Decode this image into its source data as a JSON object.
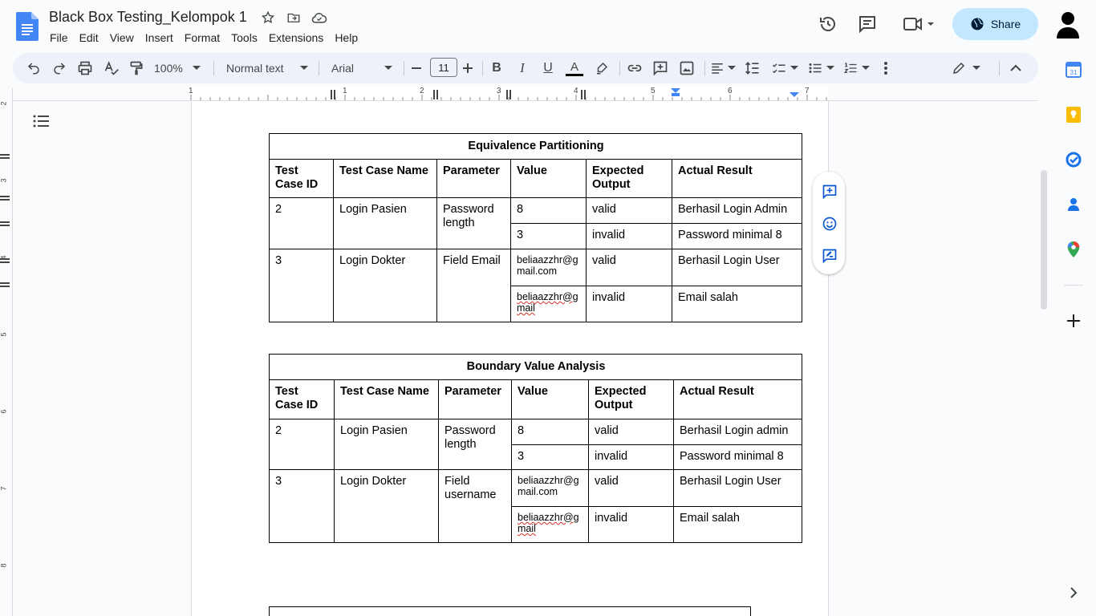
{
  "document": {
    "title": "Black Box Testing_Kelompok 1"
  },
  "menu": {
    "items": [
      "File",
      "Edit",
      "View",
      "Insert",
      "Format",
      "Tools",
      "Extensions",
      "Help"
    ]
  },
  "header": {
    "share_label": "Share"
  },
  "toolbar": {
    "zoom": "100%",
    "style": "Normal text",
    "font": "Arial",
    "font_size": "11"
  },
  "ruler": {
    "numbers": [
      "1",
      "1",
      "2",
      "3",
      "4",
      "5",
      "6",
      "7"
    ]
  },
  "vruler": {
    "numbers": [
      "2",
      "3",
      "4",
      "5",
      "6",
      "7",
      "8"
    ]
  },
  "table1": {
    "title": "Equivalence Partitioning",
    "headers": [
      "Test Case ID",
      "Test Case Name",
      "Parameter",
      "Value",
      "Expected Output",
      "Actual Result"
    ],
    "rows": [
      {
        "id": "2",
        "name": "Login Pasien",
        "param": "Password length",
        "sub": [
          {
            "value": "8",
            "expected": "valid",
            "actual": "Berhasil Login Admin"
          },
          {
            "value": "3",
            "expected": "invalid",
            "actual": "Password minimal 8"
          }
        ]
      },
      {
        "id": "3",
        "name": "Login Dokter",
        "param": "Field Email",
        "sub": [
          {
            "value": "beliaazzhr@gmail.com",
            "expected": "valid",
            "actual": "Berhasil Login User"
          },
          {
            "value": "beliaazzhr@gmail",
            "expected": "invalid",
            "actual": "Email salah"
          }
        ]
      }
    ]
  },
  "table2": {
    "title": "Boundary Value Analysis",
    "headers": [
      "Test Case ID",
      "Test Case Name",
      "Parameter",
      "Value",
      "Expected Output",
      "Actual Result"
    ],
    "rows": [
      {
        "id": "2",
        "name": "Login Pasien",
        "param": "Password length",
        "sub": [
          {
            "value": "8",
            "expected": "valid",
            "actual": "Berhasil Login admin"
          },
          {
            "value": "3",
            "expected": "invalid",
            "actual": "Password minimal 8"
          }
        ]
      },
      {
        "id": "3",
        "name": "Login Dokter",
        "param": "Field username",
        "sub": [
          {
            "value": "beliaazzhr@gmail.com",
            "expected": "valid",
            "actual": "Berhasil Login User"
          },
          {
            "value": "beliaazzhr@gmail",
            "expected": "invalid",
            "actual": "Email salah"
          }
        ]
      }
    ]
  },
  "icons": {
    "title_row": [
      "star-icon",
      "move-to-folder-icon",
      "cloud-saved-icon"
    ],
    "header_right": [
      "version-history-icon",
      "comments-icon",
      "meet-icon"
    ],
    "side_panel": [
      "calendar-icon",
      "keep-icon",
      "tasks-icon",
      "contacts-icon",
      "maps-icon",
      "add-addon-icon",
      "expand-panel-icon"
    ],
    "floating": [
      "add-comment-icon",
      "add-emoji-icon",
      "suggest-edit-icon"
    ]
  },
  "colors": {
    "share_bg": "#c2e7ff",
    "toolbar_bg": "#edf2fa",
    "docs_blue": "#4285f4",
    "spellcheck": "#d93025"
  }
}
